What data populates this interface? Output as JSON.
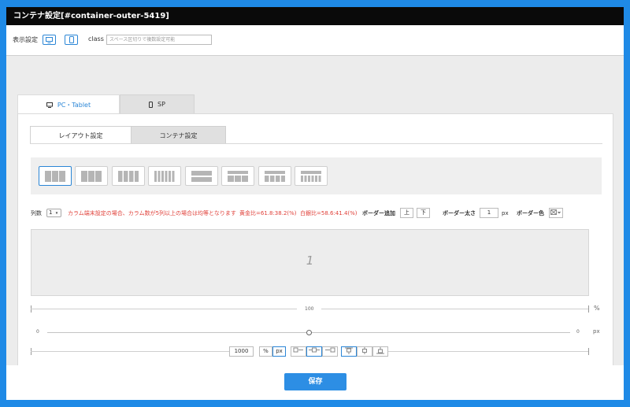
{
  "window": {
    "title": "コンテナ設定[#container-outer-5419]"
  },
  "display": {
    "label": "表示設定",
    "class_label": "class",
    "class_placeholder": "スペース区切りで複数設定可能"
  },
  "tabs": [
    {
      "label": "PC・Tablet",
      "icon": "desktop-icon"
    },
    {
      "label": "SP",
      "icon": "mobile-icon"
    }
  ],
  "subtabs": [
    {
      "label": "レイアウト設定"
    },
    {
      "label": "コンテナ設定"
    }
  ],
  "layout_options": [
    {
      "name": "3-cols"
    },
    {
      "name": "3-cols-b"
    },
    {
      "name": "4-cols"
    },
    {
      "name": "6-cols"
    },
    {
      "name": "rows-2"
    },
    {
      "name": "rows-2-3"
    },
    {
      "name": "rows-2-4"
    },
    {
      "name": "rows-2-6"
    }
  ],
  "options": {
    "columns_label": "列数",
    "columns_value": "1",
    "note": "カラム端末設定の場合、カラム数が5列以上の場合は均等となります",
    "golden_ratio": "黄金比=61.8:38.2(%)",
    "silver_ratio": "白銀比=58.6:41.4(%)",
    "border_add_label": "ボーダー追加",
    "border_top": "上",
    "border_bottom": "下",
    "border_width_label": "ボーダー太さ",
    "border_width_value": "1",
    "border_width_unit": "px",
    "border_color_label": "ボーダー色"
  },
  "preview": {
    "column_number": "1"
  },
  "ruler": {
    "percent_value": "100",
    "percent_unit": "%",
    "margin_left": "0",
    "margin_right": "0",
    "margin_unit": "px"
  },
  "width_controls": {
    "value": "1000",
    "unit_percent": "%",
    "unit_px": "px"
  },
  "footer": {
    "save_label": "保存"
  },
  "colors": {
    "accent": "#2b86d6",
    "note": "#e0413a",
    "save": "#2d8ee4"
  }
}
